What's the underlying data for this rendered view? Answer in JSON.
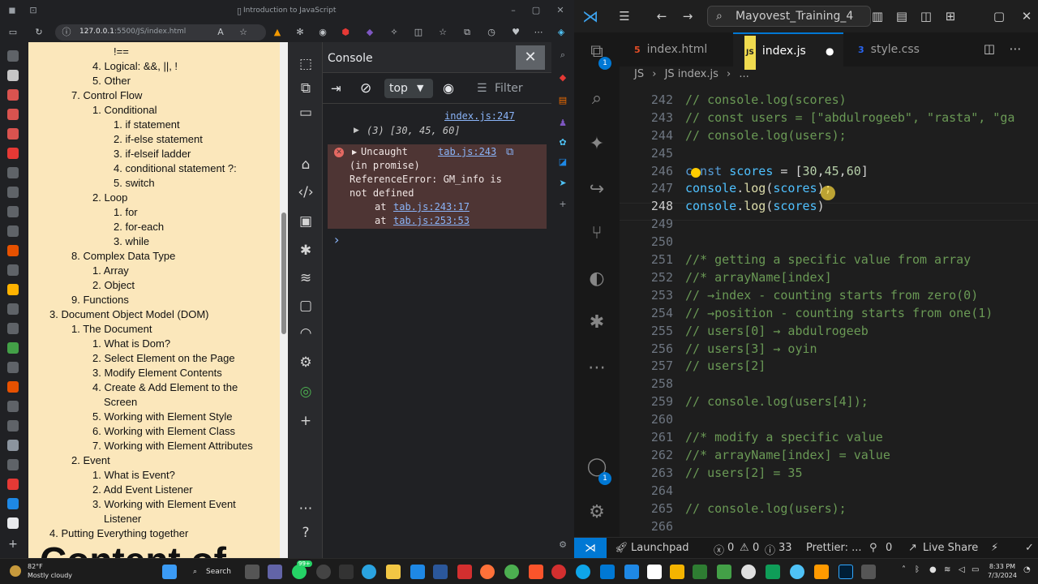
{
  "browser": {
    "title": "Introduction to JavaScript",
    "url_host": "127.0.0.1",
    "url_path": ":5500/JS/index.html"
  },
  "doc": {
    "lines": [
      {
        "text": "!==",
        "indent": 4
      },
      {
        "text": "4. Logical: &&, ||, !",
        "indent": 3
      },
      {
        "text": "5. Other",
        "indent": 3
      },
      {
        "text": "7. Control Flow",
        "indent": 2
      },
      {
        "text": "1. Conditional",
        "indent": 3
      },
      {
        "text": "1. if statement",
        "indent": 4
      },
      {
        "text": "2. if-else statement",
        "indent": 4
      },
      {
        "text": "3. if-elseif ladder",
        "indent": 4
      },
      {
        "text": "4. conditional statement ?:",
        "indent": 4
      },
      {
        "text": "5. switch",
        "indent": 4
      },
      {
        "text": "2. Loop",
        "indent": 3
      },
      {
        "text": "1. for",
        "indent": 4
      },
      {
        "text": "2. for-each",
        "indent": 4
      },
      {
        "text": "3. while",
        "indent": 4
      },
      {
        "text": "8. Complex Data Type",
        "indent": 2
      },
      {
        "text": "1. Array",
        "indent": 3
      },
      {
        "text": "2. Object",
        "indent": 3
      },
      {
        "text": "9. Functions",
        "indent": 2
      },
      {
        "text": "3. Document Object Model (DOM)",
        "indent": 1
      },
      {
        "text": "1. The Document",
        "indent": 2
      },
      {
        "text": "1. What is Dom?",
        "indent": 3
      },
      {
        "text": "2. Select Element on the Page",
        "indent": 3
      },
      {
        "text": "3. Modify Element Contents",
        "indent": 3
      },
      {
        "text": "4. Create & Add Element to the",
        "indent": 3
      },
      {
        "text": "Screen",
        "indent": 3.5
      },
      {
        "text": "5. Working with Element Style",
        "indent": 3
      },
      {
        "text": "6. Working with Element Class",
        "indent": 3
      },
      {
        "text": "7. Working with Element Attributes",
        "indent": 3
      },
      {
        "text": "2. Event",
        "indent": 2
      },
      {
        "text": "1. What is Event?",
        "indent": 3
      },
      {
        "text": "2. Add Event Listener",
        "indent": 3
      },
      {
        "text": "3. Working with Element Event",
        "indent": 3
      },
      {
        "text": "Listener",
        "indent": 3.5
      },
      {
        "text": "4. Putting Everything together",
        "indent": 1
      }
    ],
    "big_heading": "Content of"
  },
  "console": {
    "title": "Console",
    "context": "top",
    "filter_placeholder": "Filter",
    "log_source": "index.js:247",
    "log_value": "(3) [30, 45, 60]",
    "error_title": "Uncaught",
    "error_source": "tab.js:243",
    "error_lines": [
      "(in promise)",
      "ReferenceError: GM_info is",
      "not defined"
    ],
    "stack": [
      {
        "prefix": "at",
        "link": "tab.js:243:17"
      },
      {
        "prefix": "at",
        "link": "tab.js:253:53"
      }
    ],
    "prompt": "›"
  },
  "vscode": {
    "search": "Mayovest_Training_4",
    "tabs": [
      {
        "icon": "5",
        "label": "index.html"
      },
      {
        "icon": "JS",
        "label": "index.js",
        "modified": "●"
      },
      {
        "icon": "3",
        "label": "style.css"
      }
    ],
    "breadcrumb": [
      "JS",
      "JS index.js",
      "..."
    ],
    "explorer_badge": "1",
    "account_badge": "1",
    "lines": [
      {
        "n": "242",
        "parts": [
          [
            "c-com",
            "// console.log(scores)"
          ]
        ]
      },
      {
        "n": "243",
        "parts": [
          [
            "c-com",
            "// const users = [\"abdulrogeeb\", \"rasta\", \"ga"
          ]
        ]
      },
      {
        "n": "244",
        "parts": [
          [
            "c-com",
            "// console.log(users);"
          ]
        ]
      },
      {
        "n": "245",
        "parts": []
      },
      {
        "n": "246",
        "parts": [
          [
            "c-key",
            "const "
          ],
          [
            "c-var",
            "scores"
          ],
          [
            "c-plain",
            " = ["
          ],
          [
            "c-num",
            "30"
          ],
          [
            "c-plain",
            ","
          ],
          [
            "c-num",
            "45"
          ],
          [
            "c-plain",
            ","
          ],
          [
            "c-num",
            "60"
          ],
          [
            "c-plain",
            "]"
          ]
        ]
      },
      {
        "n": "247",
        "parts": [
          [
            "c-var",
            "console"
          ],
          [
            "c-plain",
            "."
          ],
          [
            "c-fn",
            "log"
          ],
          [
            "c-plain",
            "("
          ],
          [
            "c-var",
            "scores"
          ],
          [
            "c-plain",
            ");"
          ]
        ]
      },
      {
        "n": "248",
        "parts": [
          [
            "c-var",
            "console"
          ],
          [
            "c-plain",
            "."
          ],
          [
            "c-fn",
            "log"
          ],
          [
            "c-plain",
            "("
          ],
          [
            "c-var",
            "scores"
          ],
          [
            "c-plain",
            ")"
          ]
        ],
        "current": true
      },
      {
        "n": "249",
        "parts": []
      },
      {
        "n": "250",
        "parts": []
      },
      {
        "n": "251",
        "parts": [
          [
            "c-com",
            "//* getting a specific value from array"
          ]
        ]
      },
      {
        "n": "252",
        "parts": [
          [
            "c-com",
            "//* arrayName[index]"
          ]
        ]
      },
      {
        "n": "253",
        "parts": [
          [
            "c-com",
            "// →index - counting starts from zero(0)"
          ]
        ]
      },
      {
        "n": "254",
        "parts": [
          [
            "c-com",
            "// →position - counting starts from one(1)"
          ]
        ]
      },
      {
        "n": "255",
        "parts": [
          [
            "c-com",
            "// users[0] → abdulrogeeb"
          ]
        ]
      },
      {
        "n": "256",
        "parts": [
          [
            "c-com",
            "// users[3] → oyin"
          ]
        ]
      },
      {
        "n": "257",
        "parts": [
          [
            "c-com",
            "// users[2]"
          ]
        ]
      },
      {
        "n": "258",
        "parts": []
      },
      {
        "n": "259",
        "parts": [
          [
            "c-com",
            "// console.log(users[4]);"
          ]
        ]
      },
      {
        "n": "260",
        "parts": []
      },
      {
        "n": "261",
        "parts": [
          [
            "c-com",
            "//* modify a specific value"
          ]
        ]
      },
      {
        "n": "262",
        "parts": [
          [
            "c-com",
            "//* arrayName[index] = value"
          ]
        ]
      },
      {
        "n": "263",
        "parts": [
          [
            "c-com",
            "// users[2] = 35"
          ]
        ]
      },
      {
        "n": "264",
        "parts": []
      },
      {
        "n": "265",
        "parts": [
          [
            "c-com",
            "// console.log(users);"
          ]
        ]
      },
      {
        "n": "266",
        "parts": []
      }
    ],
    "status": {
      "launchpad": "Launchpad",
      "errors": "0",
      "warnings": "0",
      "info": "33",
      "prettier": "Prettier: ...",
      "ports": "0",
      "live_share": "Live Share"
    }
  },
  "taskbar": {
    "temp": "82°F",
    "weather": "Mostly cloudy",
    "search": "Search",
    "time": "8:33 PM",
    "date": "7/3/2024",
    "teams_badge": "99+"
  }
}
